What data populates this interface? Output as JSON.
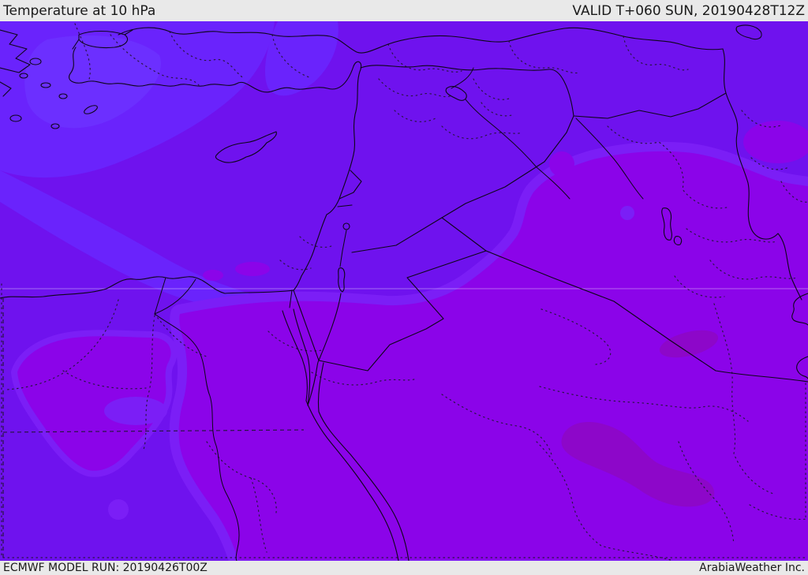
{
  "header": {
    "title": "Temperature at 10 hPa",
    "valid_label": "VALID T+060 SUN, 20190428T12Z"
  },
  "footer": {
    "model_run": "ECMWF MODEL RUN: 20190426T00Z",
    "credit": "ArabiaWeather Inc."
  },
  "map": {
    "type": "weather-temperature-contour-map",
    "region": "Eastern Mediterranean / Middle East (Turkey, Cyprus, Levant, Egypt, Iraq, Saudi Arabia)",
    "colors": {
      "bar_bg": "#e9e9e9",
      "bar_text": "#1a1a1a",
      "base": "#6f12ee",
      "cold": "#6a23fc",
      "cold2": "#6c2fff",
      "mid": "#7b1ef6",
      "warm": "#8b04e9",
      "warm_dark": "#8d07c9",
      "coast": "#0d0618",
      "admin": "#2a1446",
      "grid": "#ffffff"
    },
    "temperature_bands": [
      {
        "name": "coolest-patches",
        "hex": "#6c2fff",
        "location": "Aegean / west Turkey"
      },
      {
        "name": "cool",
        "hex": "#6a23fc",
        "location": "northwest Mediterranean sector"
      },
      {
        "name": "base-violet",
        "hex": "#6f12ee",
        "location": "Turkey, Syria, north Egypt"
      },
      {
        "name": "transition",
        "hex": "#7b1ef6",
        "location": "fringe along warm boundary"
      },
      {
        "name": "warm-magenta",
        "hex": "#8b04e9",
        "location": "Saudi Arabia, south Egypt, Iraq"
      },
      {
        "name": "warmest-spots",
        "hex": "#8d07c9",
        "location": "blobs over north Saudi Arabia"
      }
    ]
  }
}
